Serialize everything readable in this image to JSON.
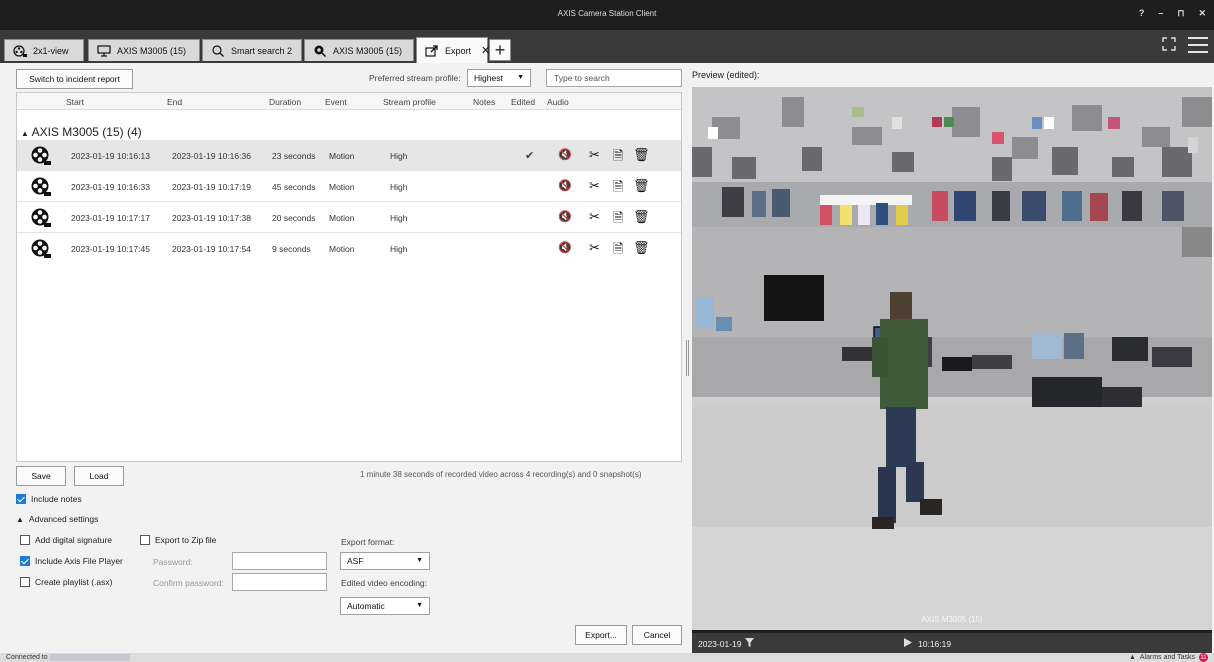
{
  "window": {
    "title": "AXIS Camera Station Client",
    "controls": [
      "?",
      "–",
      "⊓",
      "✕"
    ]
  },
  "tabs": [
    {
      "label": "2x1-view",
      "icon": "grid-view-icon"
    },
    {
      "label": "AXIS M3005 (15)",
      "icon": "monitor-icon"
    },
    {
      "label": "Smart search 2",
      "icon": "search-icon"
    },
    {
      "label": "AXIS M3005 (15)",
      "icon": "camera-search-icon"
    },
    {
      "label": "Export",
      "icon": "export-icon",
      "active": true,
      "close": "✕"
    }
  ],
  "toolbar": {
    "switch_label": "Switch to incident report",
    "stream_profile_label": "Preferred stream profile:",
    "stream_profile_value": "Highest",
    "search_placeholder": "Type to search"
  },
  "table": {
    "headers": {
      "start": "Start",
      "end": "End",
      "duration": "Duration",
      "event": "Event",
      "stream": "Stream profile",
      "notes": "Notes",
      "edited": "Edited",
      "audio": "Audio"
    },
    "group": "AXIS M3005 (15) (4)",
    "rows": [
      {
        "start": "2023-01-19 10:16:13",
        "end": "2023-01-19 10:16:36",
        "duration": "23 seconds",
        "event": "Motion",
        "stream": "High",
        "edited": "✔"
      },
      {
        "start": "2023-01-19 10:16:33",
        "end": "2023-01-19 10:17:19",
        "duration": "45 seconds",
        "event": "Motion",
        "stream": "High",
        "edited": ""
      },
      {
        "start": "2023-01-19 10:17:17",
        "end": "2023-01-19 10:17:38",
        "duration": "20 seconds",
        "event": "Motion",
        "stream": "High",
        "edited": ""
      },
      {
        "start": "2023-01-19 10:17:45",
        "end": "2023-01-19 10:17:54",
        "duration": "9 seconds",
        "event": "Motion",
        "stream": "High",
        "edited": ""
      }
    ]
  },
  "bottom": {
    "save_label": "Save",
    "load_label": "Load",
    "summary": "1 minute 38 seconds of recorded video across 4 recording(s) and 0 snapshot(s)",
    "include_notes": "Include notes",
    "advanced_settings": "Advanced settings",
    "add_signature": "Add digital signature",
    "export_zip": "Export to Zip file",
    "include_player": "Include Axis File Player",
    "create_playlist": "Create playlist (.asx)",
    "password_label": "Password:",
    "confirm_password_label": "Confirm password:",
    "export_format_label": "Export format:",
    "export_format_value": "ASF",
    "encoding_label": "Edited video encoding:",
    "encoding_value": "Automatic",
    "export_label": "Export...",
    "cancel_label": "Cancel"
  },
  "preview": {
    "title": "Preview (edited):",
    "camera_overlay": "AXIS M3005 (15)",
    "date": "2023-01-19",
    "time": "10:16:19"
  },
  "status": {
    "connected": "Connected to",
    "alarms": "Alarms and Tasks",
    "alarm_count": "11"
  }
}
